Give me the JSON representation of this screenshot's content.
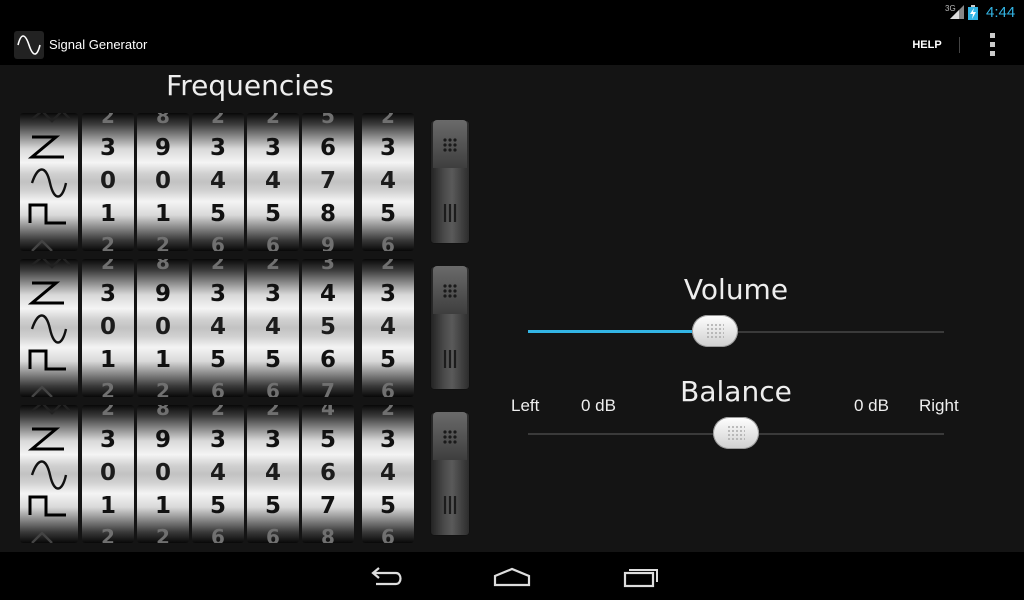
{
  "status_bar": {
    "network": "3G",
    "time": "4:44"
  },
  "action_bar": {
    "title": "Signal Generator",
    "help_label": "HELP"
  },
  "frequencies": {
    "title": "Frequencies",
    "channels": [
      {
        "digits": [
          {
            "top": "2",
            "r1": "3",
            "r2": "0",
            "r3": "1",
            "bot": "2"
          },
          {
            "top": "8",
            "r1": "9",
            "r2": "0",
            "r3": "1",
            "bot": "2"
          },
          {
            "top": "2",
            "r1": "3",
            "r2": "4",
            "r3": "5",
            "bot": "6"
          },
          {
            "top": "2",
            "r1": "3",
            "r2": "4",
            "r3": "5",
            "bot": "6"
          },
          {
            "top": "5",
            "r1": "6",
            "r2": "7",
            "r3": "8",
            "bot": "9"
          },
          {
            "top": "2",
            "r1": "3",
            "r2": "4",
            "r3": "5",
            "bot": "6"
          }
        ]
      },
      {
        "digits": [
          {
            "top": "2",
            "r1": "3",
            "r2": "0",
            "r3": "1",
            "bot": "2"
          },
          {
            "top": "8",
            "r1": "9",
            "r2": "0",
            "r3": "1",
            "bot": "2"
          },
          {
            "top": "2",
            "r1": "3",
            "r2": "4",
            "r3": "5",
            "bot": "6"
          },
          {
            "top": "2",
            "r1": "3",
            "r2": "4",
            "r3": "5",
            "bot": "6"
          },
          {
            "top": "3",
            "r1": "4",
            "r2": "5",
            "r3": "6",
            "bot": "7"
          },
          {
            "top": "2",
            "r1": "3",
            "r2": "4",
            "r3": "5",
            "bot": "6"
          }
        ]
      },
      {
        "digits": [
          {
            "top": "2",
            "r1": "3",
            "r2": "0",
            "r3": "1",
            "bot": "2"
          },
          {
            "top": "8",
            "r1": "9",
            "r2": "0",
            "r3": "1",
            "bot": "2"
          },
          {
            "top": "2",
            "r1": "3",
            "r2": "4",
            "r3": "5",
            "bot": "6"
          },
          {
            "top": "2",
            "r1": "3",
            "r2": "4",
            "r3": "5",
            "bot": "6"
          },
          {
            "top": "4",
            "r1": "5",
            "r2": "6",
            "r3": "7",
            "bot": "8"
          },
          {
            "top": "2",
            "r1": "3",
            "r2": "4",
            "r3": "5",
            "bot": "6"
          }
        ]
      }
    ]
  },
  "volume": {
    "label": "Volume",
    "level": 0.45
  },
  "balance": {
    "label": "Balance",
    "left_label": "Left",
    "left_db": "0 dB",
    "right_db": "0 dB",
    "right_label": "Right",
    "position": 0.5
  },
  "colors": {
    "accent": "#33b5e5",
    "background": "#141414"
  },
  "icons": {
    "app": "sine-wave-icon",
    "waveforms": [
      "triangle-wave-icon",
      "sawtooth-wave-icon",
      "sine-wave-icon",
      "square-wave-icon"
    ],
    "nav": [
      "back-icon",
      "home-icon",
      "recent-apps-icon"
    ]
  }
}
